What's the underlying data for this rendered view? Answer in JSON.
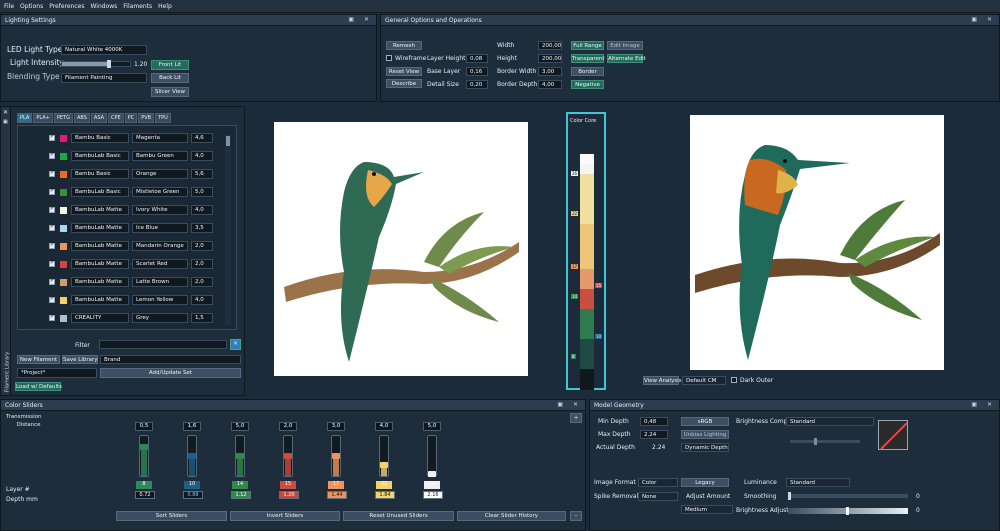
{
  "menu": [
    "File",
    "Options",
    "Preferences",
    "Windows",
    "Filaments",
    "Help"
  ],
  "lighting": {
    "title": "Lighting Settings",
    "led_label": "LED Light Type",
    "led_value": "Natural White 4000K",
    "front_lit": "Front Lit",
    "intensity_label": "Light Intensity",
    "intensity_value": "1.20",
    "back_lit": "Back Lit",
    "blending_label": "Blending Type",
    "blending_value": "Filament Painting",
    "slicer_view": "Slicer View"
  },
  "general": {
    "title": "General Options and Operations",
    "remesh": "Remesh",
    "wireframe": "Wireframe",
    "reset_view": "Reset View",
    "describe": "Describe",
    "layer_height_label": "Layer Height",
    "layer_height": "0,08",
    "base_layer_label": "Base Layer",
    "base_layer": "0,16",
    "detail_size_label": "Detail Size",
    "detail_size": "0,20",
    "width_label": "Width",
    "width": "200,00",
    "height_label": "Height",
    "height": "200,00",
    "border_width_label": "Border Width",
    "border_width": "3,00",
    "border_depth_label": "Border Depth",
    "border_depth": "4,00",
    "full_range": "Full Range",
    "edit_image": "Edit Image",
    "transparent": "Transparent",
    "alternate_edit": "Alternate Edit",
    "border": "Border",
    "negative": "Negative"
  },
  "library": {
    "side_label": "Filament Library",
    "tabs": [
      "PLA",
      "PLA+",
      "PETG",
      "ABS",
      "ASA",
      "CPE",
      "PC",
      "PVB",
      "TPU"
    ],
    "rows": [
      {
        "brand": "Bambu Basic",
        "name": "Magenta",
        "td": "4,6",
        "color": "#e0197d"
      },
      {
        "brand": "BambuLab Basic",
        "name": "Bambu Green",
        "td": "4,0",
        "color": "#18a84a"
      },
      {
        "brand": "Bambu Basic",
        "name": "Orange",
        "td": "5,6",
        "color": "#f26b1d"
      },
      {
        "brand": "BambuLab Basic",
        "name": "Mistletoe Green",
        "td": "5,0",
        "color": "#3f8c3a"
      },
      {
        "brand": "BambuLab Matte",
        "name": "Ivory White",
        "td": "4,0",
        "color": "#f5f2ea"
      },
      {
        "brand": "BambuLab Matte",
        "name": "Ice Blue",
        "td": "3,5",
        "color": "#a6d8ee"
      },
      {
        "brand": "BambuLab Matte",
        "name": "Mandarin Orange",
        "td": "2,0",
        "color": "#f0925a"
      },
      {
        "brand": "BambuLab Matte",
        "name": "Scarlet Red",
        "td": "2,0",
        "color": "#d8443a"
      },
      {
        "brand": "BambuLab Matte",
        "name": "Latte Brown",
        "td": "2,0",
        "color": "#d39a6a"
      },
      {
        "brand": "BambuLab Matte",
        "name": "Lemon Yellow",
        "td": "4,0",
        "color": "#f3d26a"
      },
      {
        "brand": "CREALITY",
        "name": "Grey",
        "td": "1,5",
        "color": "#b6bcc3"
      }
    ],
    "filter_label": "Filter",
    "new_filament": "New Filament",
    "save_library": "Save Library",
    "brand_field": "Brand",
    "project": "*Project*",
    "add_update": "Add/Update Set",
    "load_defaults": "Load w/ Defaults"
  },
  "color_core": {
    "title": "Color Core",
    "markers": [
      "26",
      "22",
      "17",
      "15",
      "14",
      "10",
      "8"
    ]
  },
  "view": {
    "view_analysis": "View Analysis",
    "default_cm": "Default CM",
    "dark_outer": "Dark Outer"
  },
  "sliders": {
    "title": "Color Sliders",
    "td_label": "Transmission\nDistance",
    "layer_label": "Layer #",
    "depth_label": "Depth mm",
    "items": [
      {
        "td": "0,5",
        "layer": "8",
        "depth": "0.72",
        "color": "#2e8a57",
        "depth_bg": "#0e161e",
        "depth_fg": "#ffffff",
        "fill": 0.75
      },
      {
        "td": "1,6",
        "layer": "10",
        "depth": "0.88",
        "color": "#1d5f86",
        "depth_bg": "#0e161e",
        "depth_fg": "#7fc3f0",
        "fill": 0.5
      },
      {
        "td": "5,0",
        "layer": "14",
        "depth": "1.12",
        "color": "#2f8a4a",
        "depth_bg": "#2f8a4a",
        "depth_fg": "#ffffff",
        "fill": 0.5
      },
      {
        "td": "2,0",
        "layer": "15",
        "depth": "1.20",
        "color": "#d04a3f",
        "depth_bg": "#c9473b",
        "depth_fg": "#ffffff",
        "fill": 0.5
      },
      {
        "td": "3,0",
        "layer": "17",
        "depth": "1.44",
        "color": "#f0925a",
        "depth_bg": "#f0925a",
        "depth_fg": "#1a1a1a",
        "fill": 0.5
      },
      {
        "td": "4,0",
        "layer": "22",
        "depth": "1.84",
        "color": "#f3d26a",
        "depth_bg": "#f3d26a",
        "depth_fg": "#1a1a1a",
        "fill": 0.25
      },
      {
        "td": "5,0",
        "layer": "26",
        "depth": "2.16",
        "color": "#f0f0f0",
        "depth_bg": "#ffffff",
        "depth_fg": "#1a1a1a",
        "fill": 0.0
      }
    ],
    "sort": "Sort Sliders",
    "invert": "Invert Sliders",
    "reset_unused": "Reset Unused Sliders",
    "clear_history": "Clear Slider History"
  },
  "geometry": {
    "title": "Model Geometry",
    "min_depth_label": "Min Depth",
    "min_depth": "0,48",
    "max_depth_label": "Max Depth",
    "max_depth": "2,24",
    "actual_depth_label": "Actual Depth",
    "actual_depth": "2.24",
    "srgb": "sRGB",
    "unbias": "Unbias Lighting",
    "dynamic_depth": "Dynamic Depth",
    "brightness_comp_label": "Brightness Comp",
    "brightness_comp": "Standard",
    "image_format_label": "Image Format",
    "image_format": "Color",
    "legacy": "Legacy",
    "spike_label": "Spike Removal",
    "spike": "None",
    "adjust_label": "Adjust Amount",
    "medium": "Medium",
    "luminance_label": "Luminance",
    "luminance": "Standard",
    "smoothing_label": "Smoothing",
    "smoothing_value": "0",
    "brightness_adjust_label": "Brightness Adjust",
    "brightness_adjust_value": "0"
  }
}
